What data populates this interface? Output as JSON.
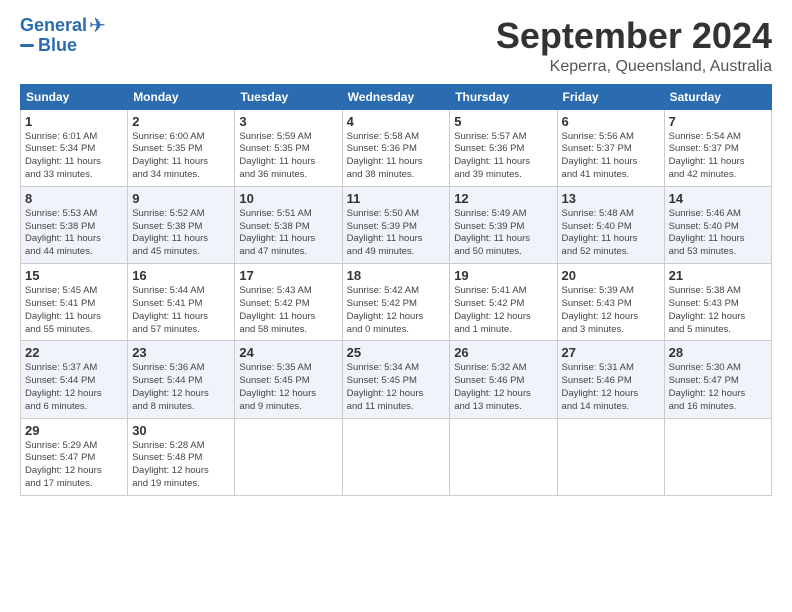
{
  "header": {
    "logo_line1": "General",
    "logo_line2": "Blue",
    "month_title": "September 2024",
    "location": "Keperra, Queensland, Australia"
  },
  "weekdays": [
    "Sunday",
    "Monday",
    "Tuesday",
    "Wednesday",
    "Thursday",
    "Friday",
    "Saturday"
  ],
  "weeks": [
    [
      {
        "day": "1",
        "info": "Sunrise: 6:01 AM\nSunset: 5:34 PM\nDaylight: 11 hours\nand 33 minutes."
      },
      {
        "day": "2",
        "info": "Sunrise: 6:00 AM\nSunset: 5:35 PM\nDaylight: 11 hours\nand 34 minutes."
      },
      {
        "day": "3",
        "info": "Sunrise: 5:59 AM\nSunset: 5:35 PM\nDaylight: 11 hours\nand 36 minutes."
      },
      {
        "day": "4",
        "info": "Sunrise: 5:58 AM\nSunset: 5:36 PM\nDaylight: 11 hours\nand 38 minutes."
      },
      {
        "day": "5",
        "info": "Sunrise: 5:57 AM\nSunset: 5:36 PM\nDaylight: 11 hours\nand 39 minutes."
      },
      {
        "day": "6",
        "info": "Sunrise: 5:56 AM\nSunset: 5:37 PM\nDaylight: 11 hours\nand 41 minutes."
      },
      {
        "day": "7",
        "info": "Sunrise: 5:54 AM\nSunset: 5:37 PM\nDaylight: 11 hours\nand 42 minutes."
      }
    ],
    [
      {
        "day": "8",
        "info": "Sunrise: 5:53 AM\nSunset: 5:38 PM\nDaylight: 11 hours\nand 44 minutes."
      },
      {
        "day": "9",
        "info": "Sunrise: 5:52 AM\nSunset: 5:38 PM\nDaylight: 11 hours\nand 45 minutes."
      },
      {
        "day": "10",
        "info": "Sunrise: 5:51 AM\nSunset: 5:38 PM\nDaylight: 11 hours\nand 47 minutes."
      },
      {
        "day": "11",
        "info": "Sunrise: 5:50 AM\nSunset: 5:39 PM\nDaylight: 11 hours\nand 49 minutes."
      },
      {
        "day": "12",
        "info": "Sunrise: 5:49 AM\nSunset: 5:39 PM\nDaylight: 11 hours\nand 50 minutes."
      },
      {
        "day": "13",
        "info": "Sunrise: 5:48 AM\nSunset: 5:40 PM\nDaylight: 11 hours\nand 52 minutes."
      },
      {
        "day": "14",
        "info": "Sunrise: 5:46 AM\nSunset: 5:40 PM\nDaylight: 11 hours\nand 53 minutes."
      }
    ],
    [
      {
        "day": "15",
        "info": "Sunrise: 5:45 AM\nSunset: 5:41 PM\nDaylight: 11 hours\nand 55 minutes."
      },
      {
        "day": "16",
        "info": "Sunrise: 5:44 AM\nSunset: 5:41 PM\nDaylight: 11 hours\nand 57 minutes."
      },
      {
        "day": "17",
        "info": "Sunrise: 5:43 AM\nSunset: 5:42 PM\nDaylight: 11 hours\nand 58 minutes."
      },
      {
        "day": "18",
        "info": "Sunrise: 5:42 AM\nSunset: 5:42 PM\nDaylight: 12 hours\nand 0 minutes."
      },
      {
        "day": "19",
        "info": "Sunrise: 5:41 AM\nSunset: 5:42 PM\nDaylight: 12 hours\nand 1 minute."
      },
      {
        "day": "20",
        "info": "Sunrise: 5:39 AM\nSunset: 5:43 PM\nDaylight: 12 hours\nand 3 minutes."
      },
      {
        "day": "21",
        "info": "Sunrise: 5:38 AM\nSunset: 5:43 PM\nDaylight: 12 hours\nand 5 minutes."
      }
    ],
    [
      {
        "day": "22",
        "info": "Sunrise: 5:37 AM\nSunset: 5:44 PM\nDaylight: 12 hours\nand 6 minutes."
      },
      {
        "day": "23",
        "info": "Sunrise: 5:36 AM\nSunset: 5:44 PM\nDaylight: 12 hours\nand 8 minutes."
      },
      {
        "day": "24",
        "info": "Sunrise: 5:35 AM\nSunset: 5:45 PM\nDaylight: 12 hours\nand 9 minutes."
      },
      {
        "day": "25",
        "info": "Sunrise: 5:34 AM\nSunset: 5:45 PM\nDaylight: 12 hours\nand 11 minutes."
      },
      {
        "day": "26",
        "info": "Sunrise: 5:32 AM\nSunset: 5:46 PM\nDaylight: 12 hours\nand 13 minutes."
      },
      {
        "day": "27",
        "info": "Sunrise: 5:31 AM\nSunset: 5:46 PM\nDaylight: 12 hours\nand 14 minutes."
      },
      {
        "day": "28",
        "info": "Sunrise: 5:30 AM\nSunset: 5:47 PM\nDaylight: 12 hours\nand 16 minutes."
      }
    ],
    [
      {
        "day": "29",
        "info": "Sunrise: 5:29 AM\nSunset: 5:47 PM\nDaylight: 12 hours\nand 17 minutes."
      },
      {
        "day": "30",
        "info": "Sunrise: 5:28 AM\nSunset: 5:48 PM\nDaylight: 12 hours\nand 19 minutes."
      },
      {
        "day": "",
        "info": ""
      },
      {
        "day": "",
        "info": ""
      },
      {
        "day": "",
        "info": ""
      },
      {
        "day": "",
        "info": ""
      },
      {
        "day": "",
        "info": ""
      }
    ]
  ]
}
